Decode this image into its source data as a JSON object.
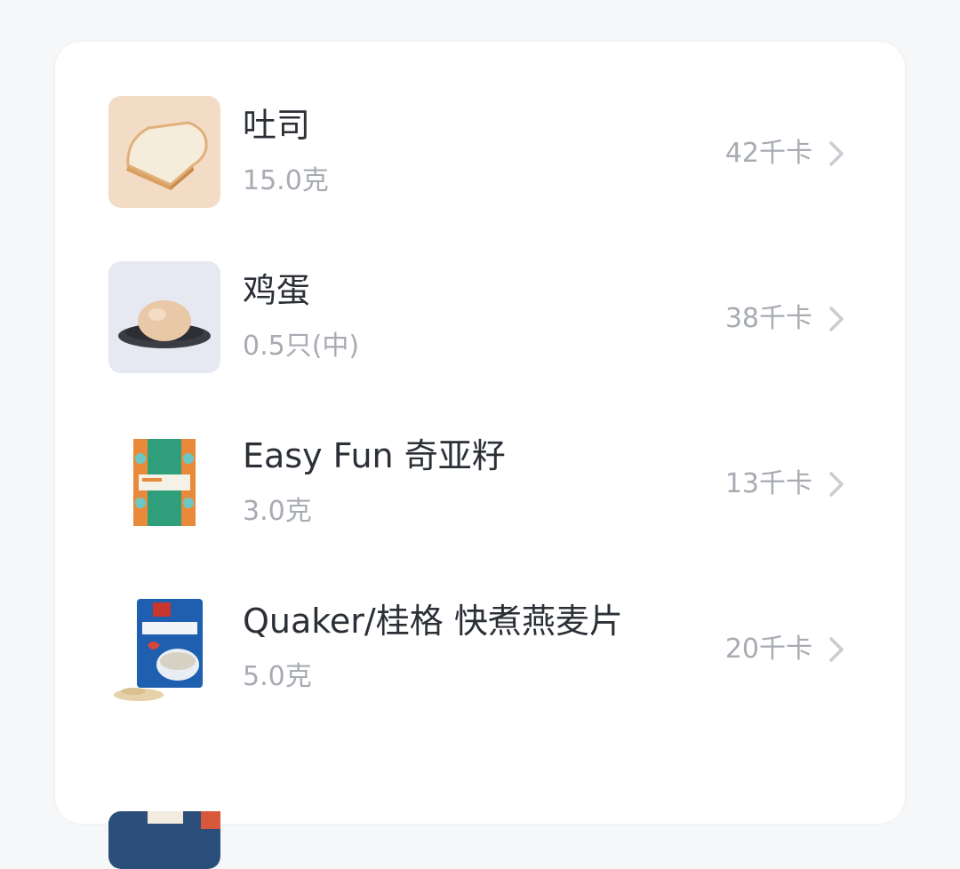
{
  "food_list": {
    "items": [
      {
        "name": "吐司",
        "amount": "15.0克",
        "kcal": "42千卡",
        "image_icon": "toast-image"
      },
      {
        "name": "鸡蛋",
        "amount": "0.5只(中)",
        "kcal": "38千卡",
        "image_icon": "egg-image"
      },
      {
        "name": "Easy Fun 奇亚籽",
        "amount": "3.0克",
        "kcal": "13千卡",
        "image_icon": "chia-seed-package-image"
      },
      {
        "name": "Quaker/桂格 快煮燕麦片",
        "amount": "5.0克",
        "kcal": "20千卡",
        "image_icon": "oatmeal-bag-image"
      }
    ],
    "chevron_icon": "chevron-right-icon"
  }
}
